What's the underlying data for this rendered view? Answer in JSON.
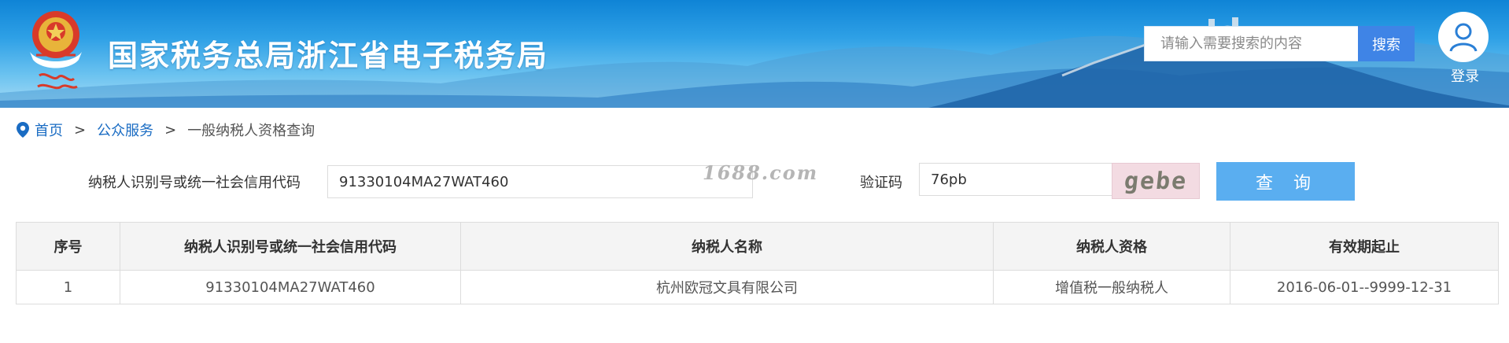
{
  "header": {
    "site_title": "国家税务总局浙江省电子税务局",
    "search_placeholder": "请输入需要搜索的内容",
    "search_button": "搜索",
    "login_label": "登录",
    "colors": {
      "banner_top": "#0f84d6",
      "search_button": "#3f84e6",
      "title_text": "#ffffff"
    }
  },
  "breadcrumb": {
    "items": [
      "首页",
      "公众服务"
    ],
    "separator": ">",
    "current": "一般纳税人资格查询"
  },
  "query_form": {
    "taxpayer_id_label": "纳税人识别号或统一社会信用代码",
    "taxpayer_id_value": "91330104MA27WAT460",
    "captcha_label": "验证码",
    "captcha_value": "76pb",
    "captcha_image_text": "gebe",
    "query_button": "查 询",
    "watermark": "1688.com",
    "colors": {
      "query_button": "#5aaef0"
    }
  },
  "results_table": {
    "columns": [
      "序号",
      "纳税人识别号或统一社会信用代码",
      "纳税人名称",
      "纳税人资格",
      "有效期起止"
    ],
    "rows": [
      [
        "1",
        "91330104MA27WAT460",
        "杭州欧冠文具有限公司",
        "增值税一般纳税人",
        "2016-06-01--9999-12-31"
      ]
    ]
  }
}
